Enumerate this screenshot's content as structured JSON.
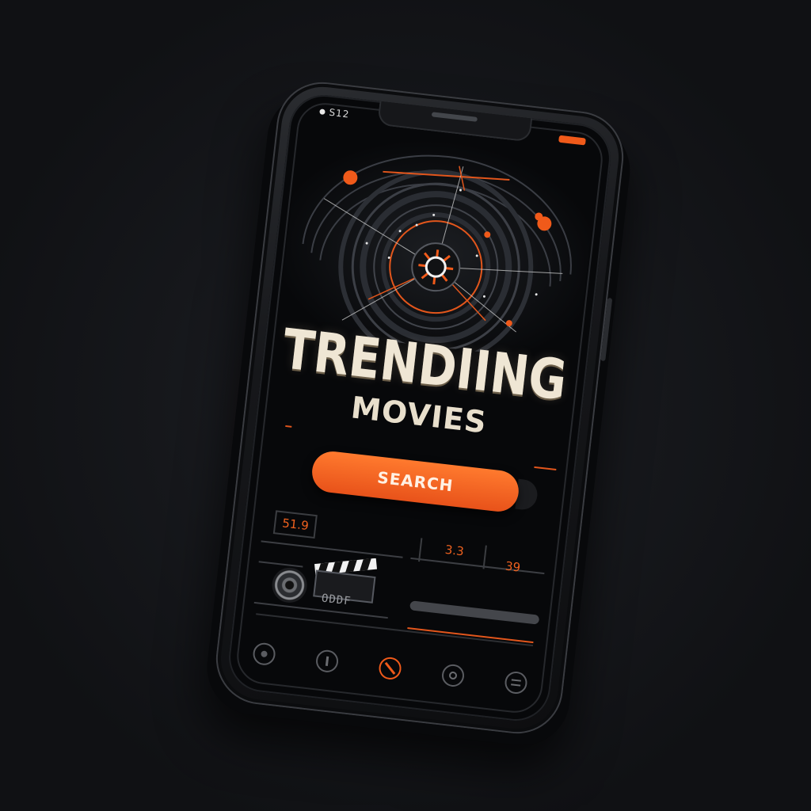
{
  "status_bar": {
    "time": "S12"
  },
  "title": {
    "line1": "TRENDIING",
    "line2": "MOVIES"
  },
  "search": {
    "label": "SEARCH"
  },
  "stats": {
    "rating_left": "51.9",
    "rating_middle": "3.3",
    "rating_right": "39",
    "clapper_text": "ODDF"
  },
  "bottom_nav": {
    "items": [
      "circle-icon",
      "pin-icon",
      "no-entry-icon",
      "eye-icon",
      "badge-icon"
    ],
    "active_index": 2
  },
  "colors": {
    "accent": "#f05a1a",
    "title": "#efe6d4",
    "screen_bg": "#07080a"
  }
}
